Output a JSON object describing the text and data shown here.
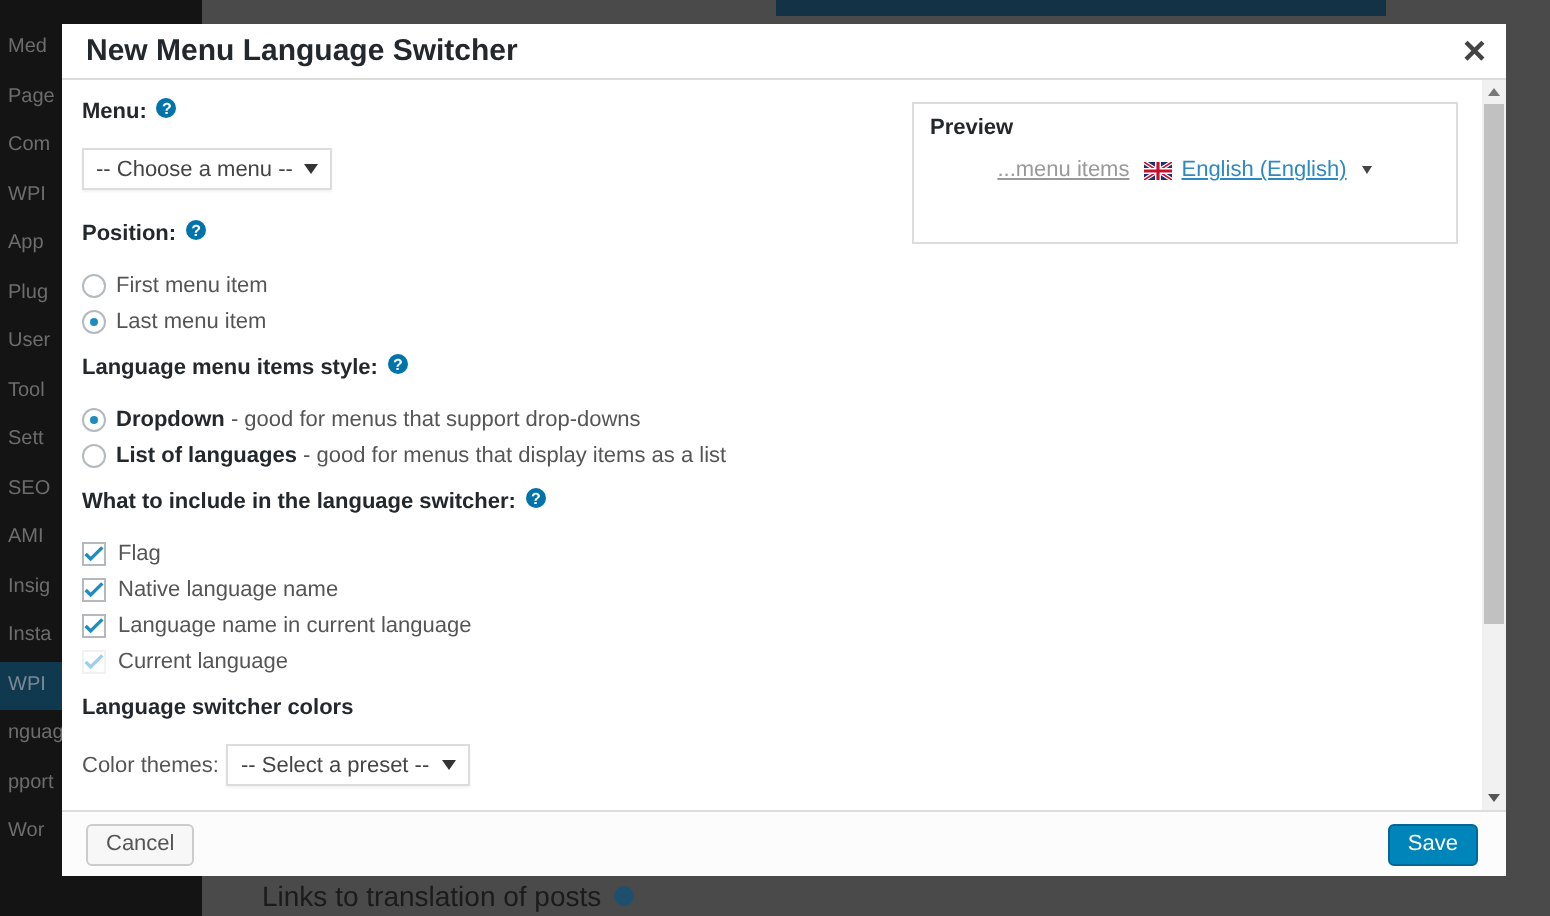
{
  "admin_sidebar": {
    "items": [
      {
        "label": "Med",
        "selected": false
      },
      {
        "label": "Page",
        "selected": false
      },
      {
        "label": "Com",
        "selected": false
      },
      {
        "label": "WPI",
        "selected": false
      },
      {
        "label": "App",
        "selected": false
      },
      {
        "label": "Plug",
        "selected": false
      },
      {
        "label": "User",
        "selected": false
      },
      {
        "label": "Tool",
        "selected": false
      },
      {
        "label": "Sett",
        "selected": false
      },
      {
        "label": "SEO",
        "selected": false
      },
      {
        "label": "AMI",
        "selected": false
      },
      {
        "label": "Insig",
        "selected": false
      },
      {
        "label": "Insta",
        "selected": false
      },
      {
        "label": "WPI",
        "selected": true
      },
      {
        "label": "nguag",
        "selected": false
      },
      {
        "label": "pport",
        "selected": false
      },
      {
        "label": "Wor",
        "selected": false
      }
    ]
  },
  "page_heading": "Links to translation of posts",
  "dialog": {
    "title": "New Menu Language Switcher",
    "close": "×",
    "menu_field": {
      "label": "Menu:",
      "help": "?",
      "value": "-- Choose a menu --"
    },
    "position": {
      "label": "Position:",
      "help": "?",
      "options": [
        {
          "label": "First menu item",
          "selected": false
        },
        {
          "label": "Last menu item",
          "selected": true
        }
      ]
    },
    "style": {
      "label": "Language menu items style:",
      "help": "?",
      "options": [
        {
          "label": "**Dropdown** - good for menus that support drop-downs",
          "selected": true
        },
        {
          "label": "**List of languages** - good for menus that display items as a list",
          "selected": false
        }
      ]
    },
    "include": {
      "label": "What to include in the language switcher:",
      "help": "?",
      "options": [
        {
          "label": "Flag",
          "checked": true,
          "disabled": false
        },
        {
          "label": "Native language name",
          "checked": true,
          "disabled": false
        },
        {
          "label": "Language name in current language",
          "checked": true,
          "disabled": false
        },
        {
          "label": "Current language",
          "checked": true,
          "disabled": true
        }
      ]
    },
    "colors": {
      "heading": "Language switcher colors",
      "theme_label": "Color themes:",
      "theme_value": "-- Select a preset --"
    },
    "preview": {
      "title": "Preview",
      "menu_items": "...menu items",
      "language": "English (English)"
    },
    "buttons": {
      "cancel": "Cancel",
      "save": "Save"
    }
  }
}
